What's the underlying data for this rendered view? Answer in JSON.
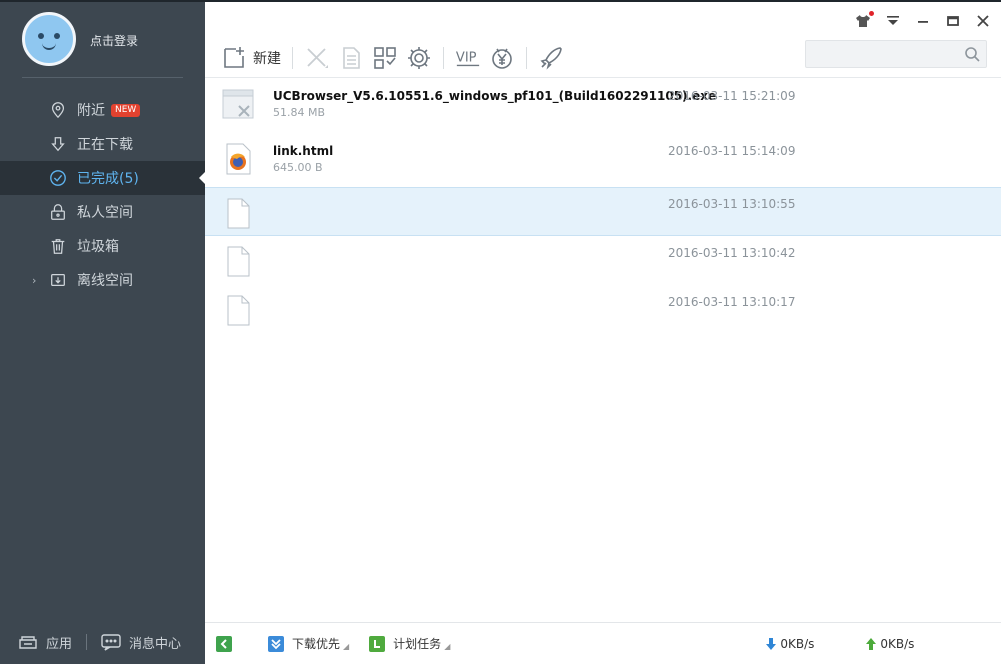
{
  "profile": {
    "login_text": "点击登录"
  },
  "nav": {
    "items": [
      {
        "label": "附近",
        "badge": "NEW"
      },
      {
        "label": "正在下载"
      },
      {
        "label": "已完成(5)",
        "active": true
      },
      {
        "label": "私人空间"
      },
      {
        "label": "垃圾箱"
      },
      {
        "label": "离线空间"
      }
    ]
  },
  "sidebar_bottom": {
    "apps_label": "应用",
    "messages_label": "消息中心"
  },
  "toolbar": {
    "new_label": "新建",
    "vip_label": "VIP"
  },
  "search": {
    "placeholder": ""
  },
  "files": [
    {
      "name": "UCBrowser_V5.6.10551.6_windows_pf101_(Build1602291105).exe",
      "size": "51.84 MB",
      "time": "2016-03-11 15:21:09",
      "icon": "exe-file-icon"
    },
    {
      "name": "link.html",
      "size": "645.00 B",
      "time": "2016-03-11 15:14:09",
      "icon": "html-file-icon"
    },
    {
      "name": "",
      "size": "",
      "time": "2016-03-11 13:10:55",
      "icon": "blank-file-icon",
      "selected": true
    },
    {
      "name": "",
      "size": "",
      "time": "2016-03-11 13:10:42",
      "icon": "blank-file-icon"
    },
    {
      "name": "",
      "size": "",
      "time": "2016-03-11 13:10:17",
      "icon": "blank-file-icon"
    }
  ],
  "statusbar": {
    "priority_label": "下载优先",
    "schedule_label": "计划任务",
    "download_speed": "0KB/s",
    "upload_speed": "0KB/s"
  },
  "colors": {
    "sidebar_bg": "#3d4750",
    "active_blue": "#5fb4ef",
    "selected_row": "#e5f2fb",
    "badge_red": "#e2422f"
  }
}
